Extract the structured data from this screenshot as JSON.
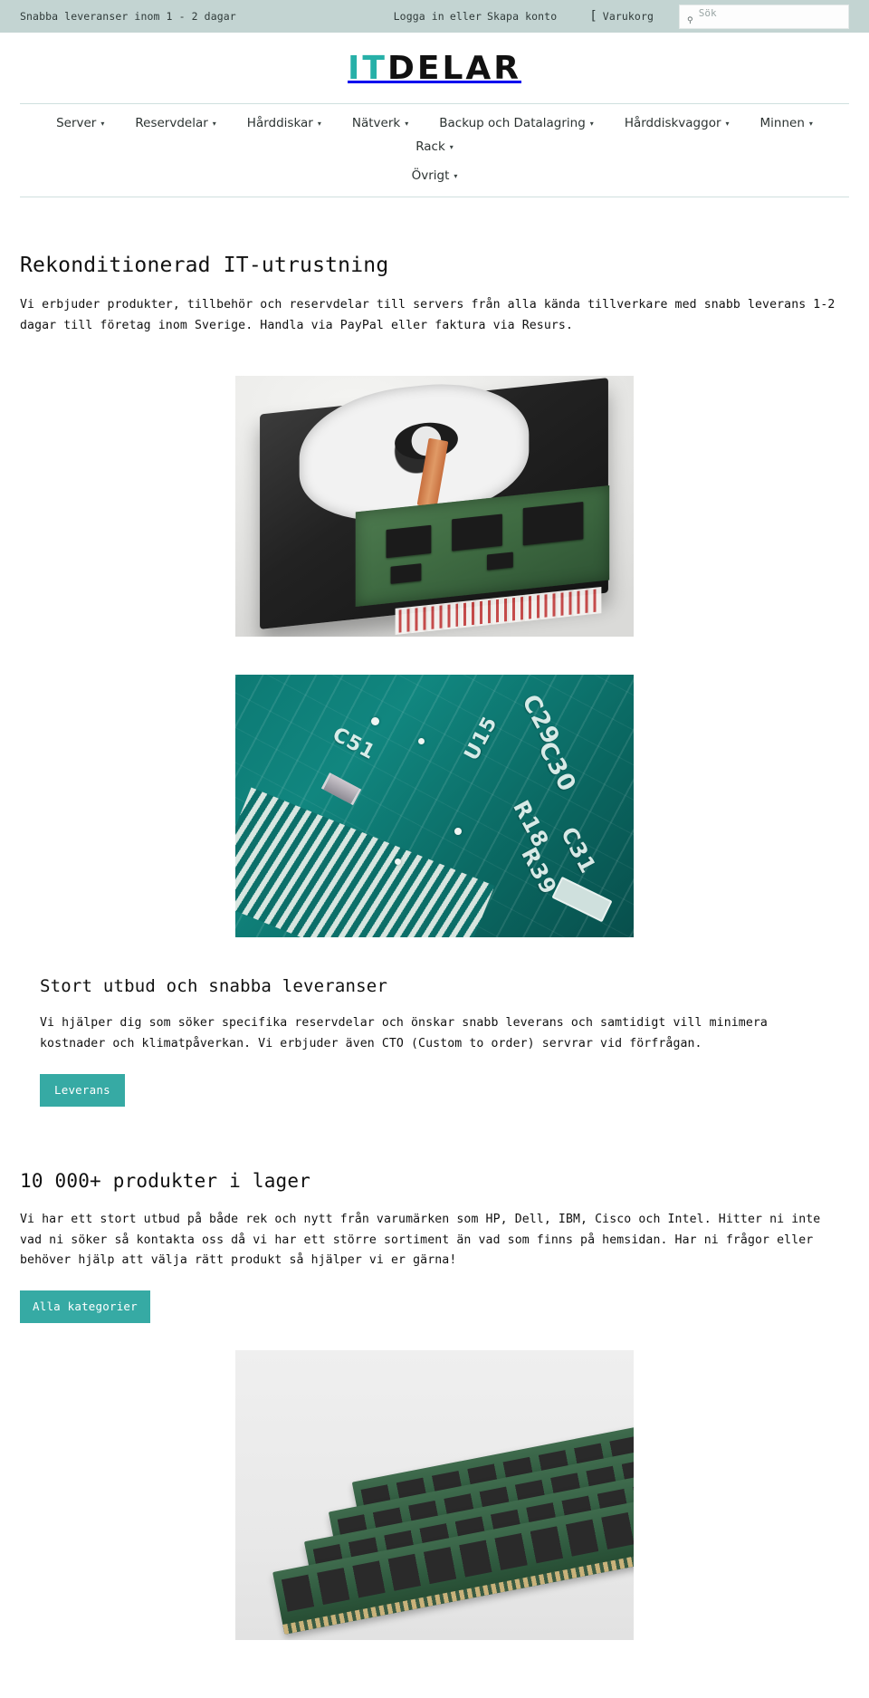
{
  "topbar": {
    "promo": "Snabba leveranser inom 1 - 2 dagar",
    "login": "Logga in",
    "separator": "eller",
    "create_account": "Skapa konto",
    "cart_label": "Varukorg",
    "cart_icon": "cart-icon",
    "search_icon": "search-icon",
    "search_placeholder": "Sök",
    "search_value": "",
    "bg_color": "#c3d4d2"
  },
  "logo": {
    "part1": "IT",
    "part2": "DELAR",
    "part1_color": "#27b0a8",
    "part2_color": "#111111"
  },
  "nav": {
    "caret": "▾",
    "row1": [
      {
        "label": "Server"
      },
      {
        "label": "Reservdelar"
      },
      {
        "label": "Hårddiskar"
      },
      {
        "label": "Nätverk"
      },
      {
        "label": "Backup och Datalagring"
      },
      {
        "label": "Hårddiskvaggor"
      },
      {
        "label": "Minnen"
      },
      {
        "label": "Rack"
      }
    ],
    "row2": [
      {
        "label": "Övrigt"
      }
    ]
  },
  "main": {
    "title": "Rekonditionerad IT-utrustning",
    "lead": "Vi erbjuder produkter, tillbehör och reservdelar till servers från alla kända tillverkare med snabb leverans 1-2 dagar till företag inom Sverige. Handla via PayPal eller faktura via Resurs.",
    "hero_image_alt": "opened-hard-drive-photo",
    "band_image_alt": "circuit-board-closeup-photo",
    "section": {
      "title": "Stort utbud och snabba leveranser",
      "text": "Vi hjälper dig som söker specifika reservdelar och önskar snabb leverans och samtidigt vill minimera kostnader och klimatpåverkan. Vi erbjuder även CTO (Custom to order) servrar vid förfrågan.",
      "button_label": "Leverans"
    },
    "block2": {
      "title": "10 000+ produkter i lager",
      "text": "Vi har ett stort utbud på både rek och nytt från varumärken som HP, Dell, IBM, Cisco och Intel. Hitter ni inte vad ni söker så kontakta oss då vi har ett större sortiment än vad som finns på hemsidan. Har ni frågor eller behöver hjälp att välja rätt produkt så hjälper vi er gärna!",
      "button_label": "Alla kategorier",
      "image_alt": "server-memory-modules-photo"
    }
  },
  "theme": {
    "accent": "#36aaa4",
    "logo_teal": "#27b0a8",
    "topbar_bg": "#c3d4d2",
    "rule_color": "#cfe0de"
  },
  "pcb_labels": {
    "c51": "C51",
    "u15": "U15",
    "c29": "C29",
    "c30": "C30",
    "r18": "R18",
    "r39": "R39",
    "c31": "C31",
    "box": "220"
  }
}
